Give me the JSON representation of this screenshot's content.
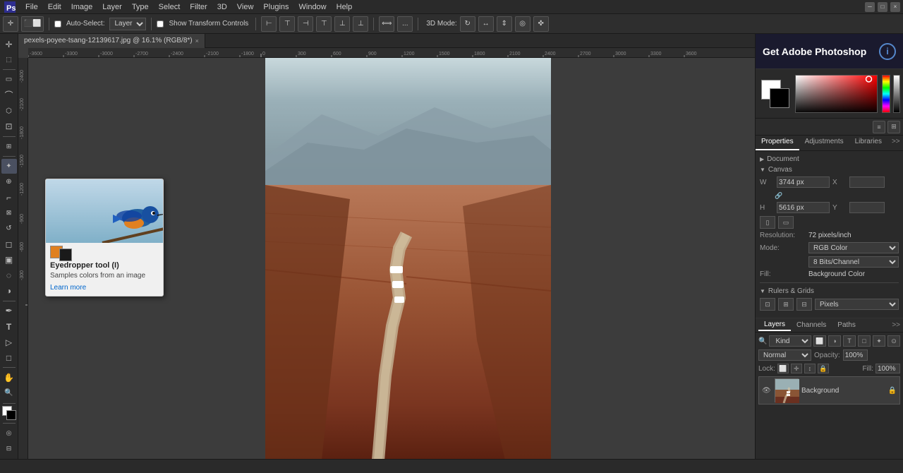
{
  "app": {
    "title": "Adobe Photoshop",
    "ps_banner": "Get Adobe Photoshop",
    "info_icon": "i"
  },
  "menu": {
    "items": [
      "File",
      "Edit",
      "Image",
      "Layer",
      "Type",
      "Select",
      "Filter",
      "3D",
      "View",
      "Plugins",
      "Window",
      "Help"
    ]
  },
  "options_bar": {
    "auto_select_label": "Auto-Select:",
    "layer_label": "Layer",
    "show_transform_label": "Show Transform Controls",
    "mode_3d": "3D Mode:",
    "more_btn": "...",
    "options_dots": "···"
  },
  "document": {
    "tab_label": "pexels-poyee-tsang-12139617.jpg @ 16.1% (RGB/8*)",
    "filename": "pexels-poyee-tsang-12139617.jpg @ 16.1% (RGB/8*)"
  },
  "canvas": {
    "width_px": "3744 px",
    "height_px": "5616 px",
    "x_val": "",
    "y_val": "",
    "resolution": "72 pixels/inch",
    "mode": "RGB Color",
    "bit_depth": "8 Bits/Channel",
    "fill": "Background Color"
  },
  "rulers_grids": {
    "section_label": "Rulers & Grids",
    "unit": "Pixels"
  },
  "properties_tabs": {
    "properties": "Properties",
    "adjustments": "Adjustments",
    "libraries": "Libraries"
  },
  "properties_section": {
    "document_label": "Document",
    "canvas_label": "Canvas",
    "w_label": "W",
    "h_label": "H",
    "x_label": "X",
    "y_label": "Y"
  },
  "layers_panel": {
    "tabs": [
      "Layers",
      "Channels",
      "Paths"
    ],
    "search_placeholder": "Kind",
    "blend_mode": "Normal",
    "opacity_label": "Opacity:",
    "opacity_val": "100%",
    "lock_label": "Lock:",
    "fill_label": "Fill:",
    "fill_val": "100%",
    "layer_name": "Background"
  },
  "tooltip": {
    "title": "Eyedropper tool (I)",
    "description": "Samples colors from an image",
    "learn_more": "Learn more"
  },
  "status_bar": {
    "text": ""
  },
  "toolbox": {
    "tools": [
      {
        "name": "move",
        "icon": "✛",
        "label": "Move"
      },
      {
        "name": "artboard",
        "icon": "⬚",
        "label": "Artboard"
      },
      {
        "name": "select-rect",
        "icon": "▭",
        "label": "Rectangular Marquee"
      },
      {
        "name": "lasso",
        "icon": "⌒",
        "label": "Lasso"
      },
      {
        "name": "quick-select",
        "icon": "⬡",
        "label": "Quick Select"
      },
      {
        "name": "crop",
        "icon": "⊡",
        "label": "Crop"
      },
      {
        "name": "eyedropper",
        "icon": "𝒊",
        "label": "Eyedropper",
        "active": true
      },
      {
        "name": "healing",
        "icon": "⊕",
        "label": "Healing"
      },
      {
        "name": "brush",
        "icon": "⌐",
        "label": "Brush"
      },
      {
        "name": "clone-stamp",
        "icon": "⊠",
        "label": "Clone Stamp"
      },
      {
        "name": "history-brush",
        "icon": "↺",
        "label": "History Brush"
      },
      {
        "name": "eraser",
        "icon": "◻",
        "label": "Eraser"
      },
      {
        "name": "gradient",
        "icon": "▣",
        "label": "Gradient"
      },
      {
        "name": "blur",
        "icon": "◌",
        "label": "Blur"
      },
      {
        "name": "dodge",
        "icon": "◑",
        "label": "Dodge"
      },
      {
        "name": "pen",
        "icon": "✒",
        "label": "Pen"
      },
      {
        "name": "type",
        "icon": "T",
        "label": "Type"
      },
      {
        "name": "path-select",
        "icon": "▷",
        "label": "Path Select"
      },
      {
        "name": "rectangle",
        "icon": "□",
        "label": "Rectangle"
      },
      {
        "name": "hand",
        "icon": "✋",
        "label": "Hand"
      },
      {
        "name": "zoom",
        "icon": "🔍",
        "label": "Zoom"
      }
    ]
  }
}
